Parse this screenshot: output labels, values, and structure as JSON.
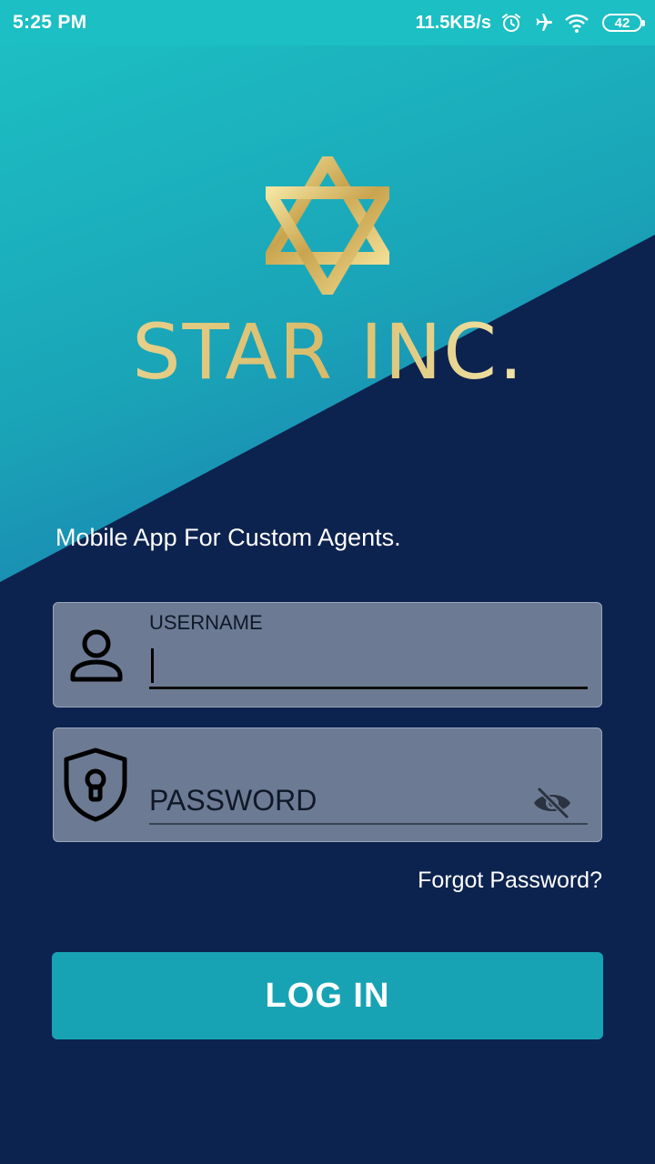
{
  "status_bar": {
    "time": "5:25 PM",
    "net_speed": "11.5KB/s",
    "battery": "42",
    "icons": [
      "alarm-icon",
      "airplane-icon",
      "wifi-icon",
      "battery-icon"
    ]
  },
  "brand": {
    "name": "STAR INC.",
    "logo_icon": "star-of-david-icon",
    "gold_color": "#e9d48a"
  },
  "tagline": "Mobile App For Custom Agents.",
  "username": {
    "label": "USERNAME",
    "value": "",
    "icon": "user-icon"
  },
  "password": {
    "placeholder": "PASSWORD",
    "icon": "shield-lock-icon",
    "toggle_icon": "eye-off-icon"
  },
  "forgot_password": "Forgot Password?",
  "login_button": "LOG IN",
  "colors": {
    "background": "#0d234f",
    "accent_teal": "#18a3b4",
    "field_bg": "#6c7b93"
  }
}
